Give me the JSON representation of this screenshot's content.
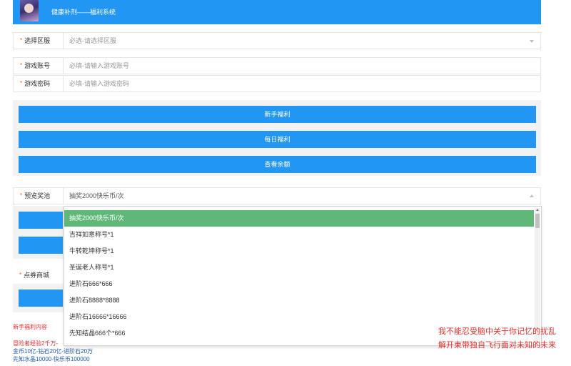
{
  "header": {
    "title": "健康补剂——福利系统"
  },
  "server": {
    "label": "选择区服",
    "placeholder": "必选-请选择区服"
  },
  "account": {
    "label": "游戏账号",
    "placeholder": "必填-请输入游戏账号"
  },
  "password": {
    "label": "游戏密码",
    "placeholder": "必填-请输入游戏密码"
  },
  "buttons": {
    "newbie": "新手福利",
    "daily": "每日福利",
    "balance": "查看余额"
  },
  "pool": {
    "label": "预览奖池",
    "selected": "抽奖2000快乐币/次",
    "options": [
      "抽奖2000快乐币/次",
      "吉祥如意称号*1",
      "牛转乾坤称号*1",
      "圣诞老人称号*1",
      "进阶石666*666",
      "进阶石8888*8888",
      "进阶石16666*16666",
      "先知结晶666个*666"
    ]
  },
  "voucher": {
    "label": "点券商城"
  },
  "notes": {
    "title": "新手福利内容",
    "line1": "冒险者经验2千万-",
    "line2": "金币10亿-钻石20亿-进阶石20万",
    "line3": "先知水晶10000-快乐币100000"
  },
  "lyrics": {
    "line1": "我不能忍受脑中关于你记忆的扰乱",
    "line2": "解开束带独自飞行面对未知的未来"
  },
  "colors": {
    "primary": "#2196f3",
    "selected": "#5fb878",
    "required": "#ff5722",
    "note": "#e52e2e"
  }
}
